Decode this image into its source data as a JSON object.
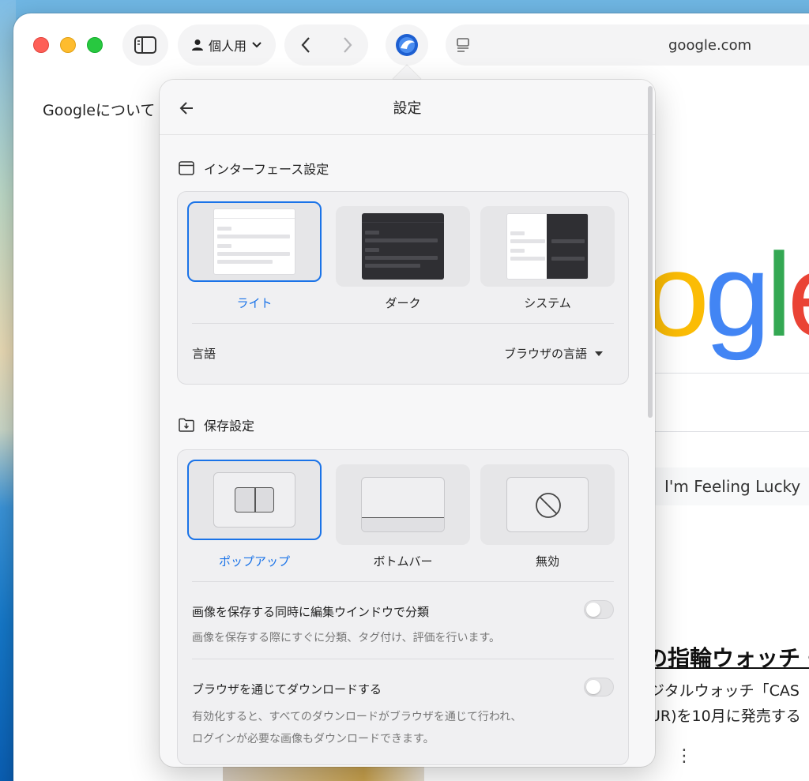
{
  "browser": {
    "profile_label": "個人用",
    "address": "google.com"
  },
  "page": {
    "about_link": "Googleについて",
    "logo_letters": [
      "o",
      "o",
      "g",
      "l",
      "e"
    ],
    "lucky_button": "I'm Feeling Lucky",
    "news_title": "の指輪ウォッチ・",
    "news_line1": "ジタルウォッチ「CAS",
    "news_line2": "UR)を10月に発売する"
  },
  "popover": {
    "title": "設定",
    "interface": {
      "heading": "インターフェース設定",
      "themes": [
        {
          "label": "ライト",
          "selected": true
        },
        {
          "label": "ダーク",
          "selected": false
        },
        {
          "label": "システム",
          "selected": false
        }
      ],
      "language_label": "言語",
      "language_value": "ブラウザの言語"
    },
    "save": {
      "heading": "保存設定",
      "modes": [
        {
          "label": "ポップアップ",
          "selected": true
        },
        {
          "label": "ボトムバー",
          "selected": false
        },
        {
          "label": "無効",
          "selected": false
        }
      ],
      "option1": {
        "label": "画像を保存する同時に編集ウインドウで分類",
        "desc": "画像を保存する際にすぐに分類、タグ付け、評価を行います。",
        "enabled": false
      },
      "option2": {
        "label": "ブラウザを通じてダウンロードする",
        "desc1": "有効化すると、すべてのダウンロードがブラウザを通じて行われ、",
        "desc2": "ログインが必要な画像もダウンロードできます。",
        "enabled": false
      }
    }
  },
  "colors": {
    "accent": "#1a73e8",
    "close": "#fe5f57",
    "minimize": "#febc2e",
    "zoom": "#28c840"
  }
}
